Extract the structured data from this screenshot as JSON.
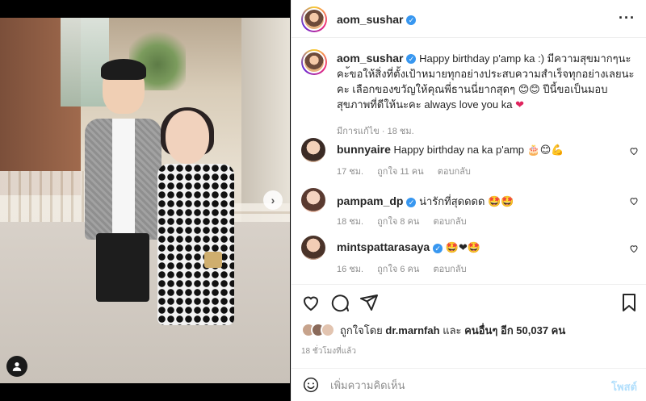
{
  "account": {
    "username": "aom_sushar"
  },
  "caption": {
    "username": "aom_sushar",
    "text": "Happy birthday p'amp ka :) มีความสุขมากๆนะคะ้ขอให้สิ่งที่ตั้งเป้าหมายทุกอย่างประสบความสำเร็จทุกอย่างเลยนะคะ เลือกของขวัญให้คุณพี่ธานนี่ยากสุดๆ 😊😊 ปีนี้ขอเป็นมอบสุขภาพที่ดีให้นะคะ always love you ka",
    "heart": "❤",
    "meta": "มีการแก้ไข · 18 ชม."
  },
  "comments": [
    {
      "username": "bunnyaire",
      "text": "Happy birthday na ka p'amp 🎂😊💪",
      "time": "17 ชม.",
      "likes": "ถูกใจ 11 คน",
      "reply": "ตอบกลับ"
    },
    {
      "username": "pampam_dp",
      "text": "น่ารักที่สุดดดด 🤩🤩",
      "time": "18 ชม.",
      "likes": "ถูกใจ 8 คน",
      "reply": "ตอบกลับ"
    },
    {
      "username": "mintspattarasaya",
      "text": "🤩❤🤩",
      "time": "16 ชม.",
      "likes": "ถูกใจ 6 คน",
      "reply": "ตอบกลับ"
    }
  ],
  "likes": {
    "prefix": "ถูกใจโดย",
    "user": "dr.marnfah",
    "and": "และ",
    "others": "คนอื่นๆ อีก 50,037 คน"
  },
  "posted_ago": "18 ชั่วโมงที่แล้ว",
  "composer": {
    "placeholder": "เพิ่มความคิดเห็น",
    "post_label": "โพสต์"
  },
  "icons": {
    "more": "more-icon",
    "verified": "verified-badge-icon",
    "like": "heart-icon",
    "comment": "comment-icon",
    "share": "paper-plane-icon",
    "save": "bookmark-icon",
    "emoji": "smiley-icon",
    "next": "chevron-right-icon",
    "tags": "user-tag-icon"
  },
  "colors": {
    "verified": "#3897f0",
    "post_button_disabled": "#b2dffc",
    "heart": "#e0245e",
    "meta_gray": "#8e8e8e"
  }
}
